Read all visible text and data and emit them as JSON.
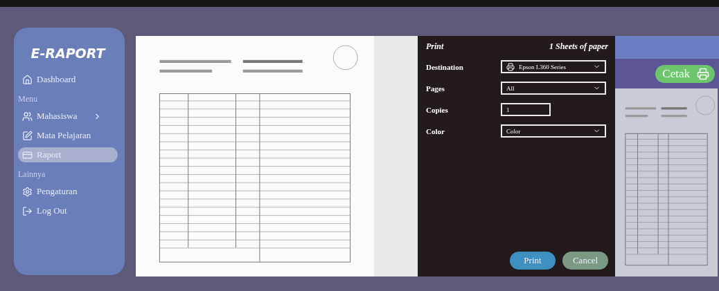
{
  "sidebar": {
    "logo": "E-RAPORT",
    "items": [
      {
        "kind": "item",
        "label": "Dashboard",
        "selected": false
      },
      {
        "kind": "heading",
        "label": "Menu"
      },
      {
        "kind": "item",
        "label": "Mahasiswa",
        "selected": false
      },
      {
        "kind": "item",
        "label": "Mata Pelajaran",
        "selected": false
      },
      {
        "kind": "item",
        "label": "Raport",
        "selected": true
      },
      {
        "kind": "heading",
        "label": "Lainnya"
      },
      {
        "kind": "item",
        "label": "Pengaturan",
        "selected": false
      },
      {
        "kind": "item",
        "label": "Log Out",
        "selected": false
      }
    ]
  },
  "print_dialog": {
    "title": "Print",
    "sheets": "1 Sheets of paper",
    "fields": [
      {
        "kind": "select",
        "label": "Destination",
        "value": "Epson L360 Series"
      },
      {
        "kind": "select",
        "label": "Pages",
        "value": "All"
      },
      {
        "kind": "input",
        "label": "Copies",
        "value": "1"
      },
      {
        "kind": "select",
        "label": "Color",
        "value": "Color"
      }
    ],
    "buttons": [
      {
        "kind": "primary",
        "label": "Print"
      },
      {
        "kind": "secondary",
        "label": "Cancel"
      }
    ]
  },
  "page_behind": {
    "print_button": "Cetak"
  }
}
